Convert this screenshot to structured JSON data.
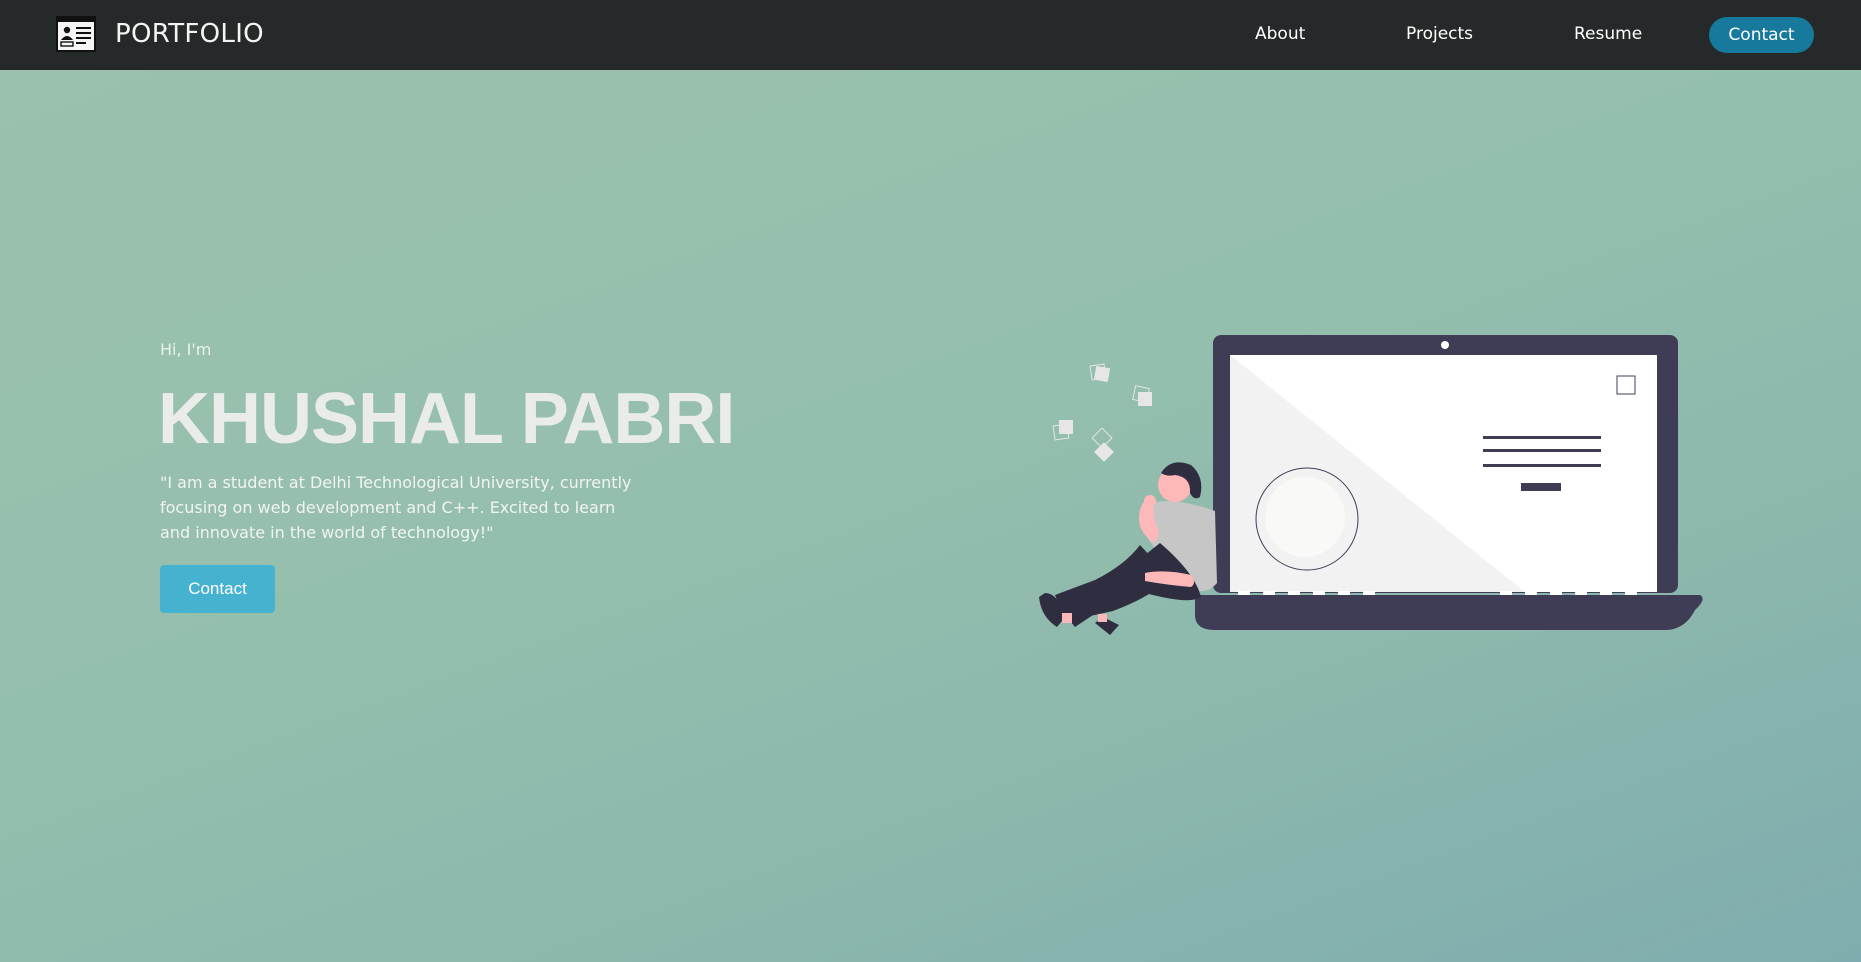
{
  "navbar": {
    "brand_icon": "portfolio-id-card-icon",
    "brand_text": "PORTFOLIO",
    "links": {
      "about": "About",
      "projects": "Projects",
      "resume": "Resume"
    },
    "contact_label": "Contact",
    "contact_color": "#177a9c",
    "background": "#262929"
  },
  "hero": {
    "greeting": "Hi, I'm",
    "name": "KHUSHAL PABRI",
    "bio": "\"I am a student at Delhi Technological University, currently focusing on web development and C++. Excited to learn and innovate in the world of technology!\"",
    "contact_label": "Contact",
    "contact_color": "#45b3cf"
  },
  "illustration": {
    "icon": "person-with-laptop-illustration",
    "laptop_color": "#3f3d56",
    "accent_color": "#ffb8b8"
  }
}
